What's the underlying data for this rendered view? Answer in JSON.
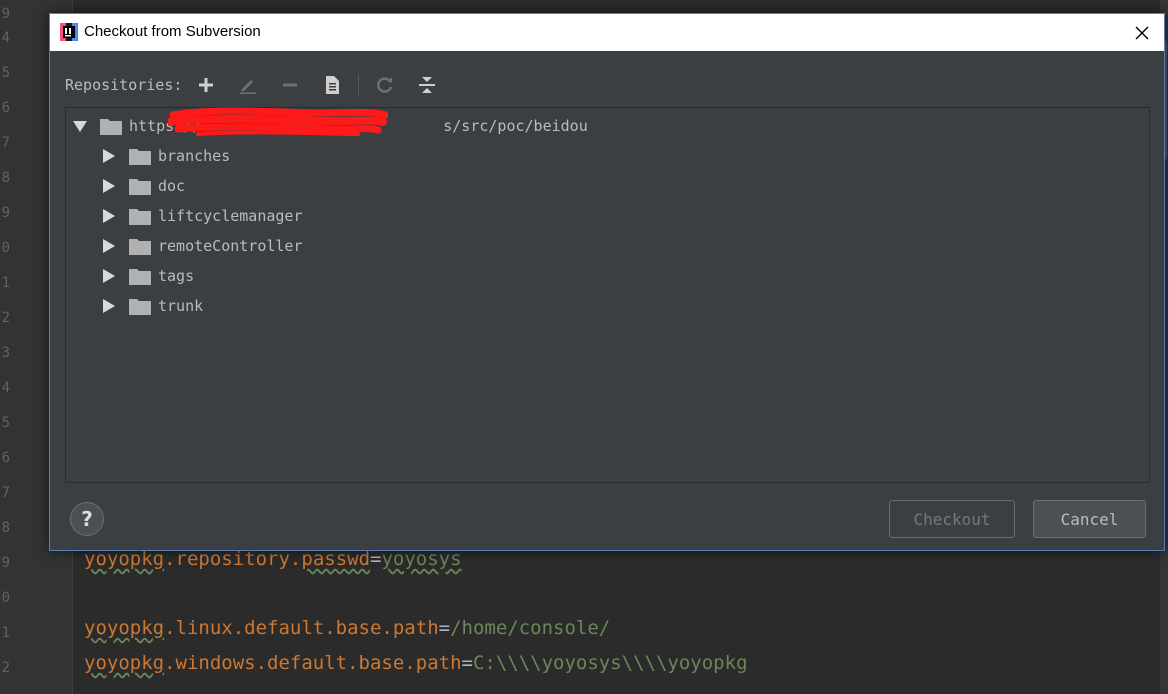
{
  "editor": {
    "gutter_numbers": [
      "9",
      "4",
      "5",
      "6",
      "7",
      "8",
      "9",
      "0",
      "1",
      "2",
      "3",
      "4",
      "5",
      "6",
      "7",
      "8",
      "9",
      "0",
      "1",
      "2"
    ],
    "lines": [
      {
        "key": "yoyopkg",
        "sep": ".",
        "rest": "repository.",
        "key2": "passwd",
        "eq": "=",
        "value": "yoyosys"
      },
      {
        "key": "yoyopkg",
        "sep": ".",
        "rest": "linux.default.base.path",
        "key2": "",
        "eq": "=",
        "value": "/home/console/"
      },
      {
        "key": "yoyopkg",
        "sep": ".",
        "rest": "windows.default.base.path",
        "key2": "",
        "eq": "=",
        "value": "C:\\\\\\\\yoyosys\\\\\\\\yoyopkg"
      }
    ]
  },
  "dialog": {
    "title": "Checkout from Subversion",
    "repositories_label": "Repositories:",
    "toolbar": {
      "add_icon": "plus-icon",
      "edit_icon": "pencil-icon",
      "remove_icon": "minus-icon",
      "browse_icon": "document-icon",
      "refresh_icon": "refresh-icon",
      "collapse_icon": "collapse-all-icon"
    },
    "tree": {
      "root": {
        "label_prefix": "https://",
        "label_suffix": "s/src/poc/beidou",
        "expanded": true
      },
      "children": [
        "branches",
        "doc",
        "liftcyclemanager",
        "remoteController",
        "tags",
        "trunk"
      ]
    },
    "buttons": {
      "help": "?",
      "checkout": "Checkout",
      "cancel": "Cancel"
    },
    "colors": {
      "accent_border": "#5a7fb8",
      "dialog_bg": "#3c3f41",
      "redaction": "#ff1a1a"
    }
  }
}
